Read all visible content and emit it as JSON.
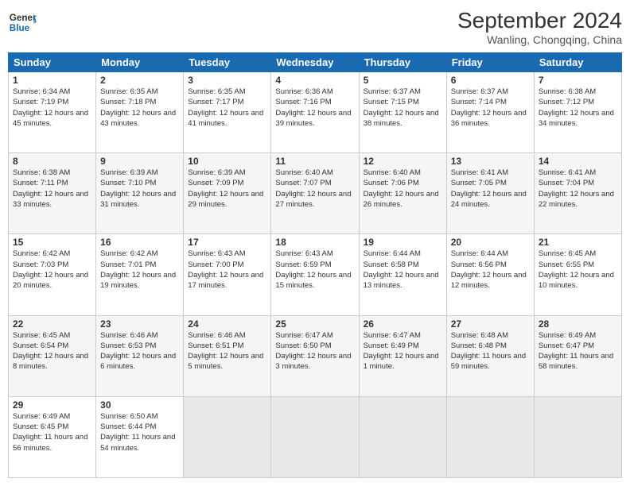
{
  "header": {
    "logo_line1": "General",
    "logo_line2": "Blue",
    "month": "September 2024",
    "location": "Wanling, Chongqing, China"
  },
  "days_of_week": [
    "Sunday",
    "Monday",
    "Tuesday",
    "Wednesday",
    "Thursday",
    "Friday",
    "Saturday"
  ],
  "weeks": [
    [
      {
        "num": "1",
        "sunrise": "6:34 AM",
        "sunset": "7:19 PM",
        "daylight": "12 hours and 45 minutes."
      },
      {
        "num": "2",
        "sunrise": "6:35 AM",
        "sunset": "7:18 PM",
        "daylight": "12 hours and 43 minutes."
      },
      {
        "num": "3",
        "sunrise": "6:35 AM",
        "sunset": "7:17 PM",
        "daylight": "12 hours and 41 minutes."
      },
      {
        "num": "4",
        "sunrise": "6:36 AM",
        "sunset": "7:16 PM",
        "daylight": "12 hours and 39 minutes."
      },
      {
        "num": "5",
        "sunrise": "6:37 AM",
        "sunset": "7:15 PM",
        "daylight": "12 hours and 38 minutes."
      },
      {
        "num": "6",
        "sunrise": "6:37 AM",
        "sunset": "7:14 PM",
        "daylight": "12 hours and 36 minutes."
      },
      {
        "num": "7",
        "sunrise": "6:38 AM",
        "sunset": "7:12 PM",
        "daylight": "12 hours and 34 minutes."
      }
    ],
    [
      {
        "num": "8",
        "sunrise": "6:38 AM",
        "sunset": "7:11 PM",
        "daylight": "12 hours and 33 minutes."
      },
      {
        "num": "9",
        "sunrise": "6:39 AM",
        "sunset": "7:10 PM",
        "daylight": "12 hours and 31 minutes."
      },
      {
        "num": "10",
        "sunrise": "6:39 AM",
        "sunset": "7:09 PM",
        "daylight": "12 hours and 29 minutes."
      },
      {
        "num": "11",
        "sunrise": "6:40 AM",
        "sunset": "7:07 PM",
        "daylight": "12 hours and 27 minutes."
      },
      {
        "num": "12",
        "sunrise": "6:40 AM",
        "sunset": "7:06 PM",
        "daylight": "12 hours and 26 minutes."
      },
      {
        "num": "13",
        "sunrise": "6:41 AM",
        "sunset": "7:05 PM",
        "daylight": "12 hours and 24 minutes."
      },
      {
        "num": "14",
        "sunrise": "6:41 AM",
        "sunset": "7:04 PM",
        "daylight": "12 hours and 22 minutes."
      }
    ],
    [
      {
        "num": "15",
        "sunrise": "6:42 AM",
        "sunset": "7:03 PM",
        "daylight": "12 hours and 20 minutes."
      },
      {
        "num": "16",
        "sunrise": "6:42 AM",
        "sunset": "7:01 PM",
        "daylight": "12 hours and 19 minutes."
      },
      {
        "num": "17",
        "sunrise": "6:43 AM",
        "sunset": "7:00 PM",
        "daylight": "12 hours and 17 minutes."
      },
      {
        "num": "18",
        "sunrise": "6:43 AM",
        "sunset": "6:59 PM",
        "daylight": "12 hours and 15 minutes."
      },
      {
        "num": "19",
        "sunrise": "6:44 AM",
        "sunset": "6:58 PM",
        "daylight": "12 hours and 13 minutes."
      },
      {
        "num": "20",
        "sunrise": "6:44 AM",
        "sunset": "6:56 PM",
        "daylight": "12 hours and 12 minutes."
      },
      {
        "num": "21",
        "sunrise": "6:45 AM",
        "sunset": "6:55 PM",
        "daylight": "12 hours and 10 minutes."
      }
    ],
    [
      {
        "num": "22",
        "sunrise": "6:45 AM",
        "sunset": "6:54 PM",
        "daylight": "12 hours and 8 minutes."
      },
      {
        "num": "23",
        "sunrise": "6:46 AM",
        "sunset": "6:53 PM",
        "daylight": "12 hours and 6 minutes."
      },
      {
        "num": "24",
        "sunrise": "6:46 AM",
        "sunset": "6:51 PM",
        "daylight": "12 hours and 5 minutes."
      },
      {
        "num": "25",
        "sunrise": "6:47 AM",
        "sunset": "6:50 PM",
        "daylight": "12 hours and 3 minutes."
      },
      {
        "num": "26",
        "sunrise": "6:47 AM",
        "sunset": "6:49 PM",
        "daylight": "12 hours and 1 minute."
      },
      {
        "num": "27",
        "sunrise": "6:48 AM",
        "sunset": "6:48 PM",
        "daylight": "11 hours and 59 minutes."
      },
      {
        "num": "28",
        "sunrise": "6:49 AM",
        "sunset": "6:47 PM",
        "daylight": "11 hours and 58 minutes."
      }
    ],
    [
      {
        "num": "29",
        "sunrise": "6:49 AM",
        "sunset": "6:45 PM",
        "daylight": "11 hours and 56 minutes."
      },
      {
        "num": "30",
        "sunrise": "6:50 AM",
        "sunset": "6:44 PM",
        "daylight": "11 hours and 54 minutes."
      },
      null,
      null,
      null,
      null,
      null
    ]
  ]
}
